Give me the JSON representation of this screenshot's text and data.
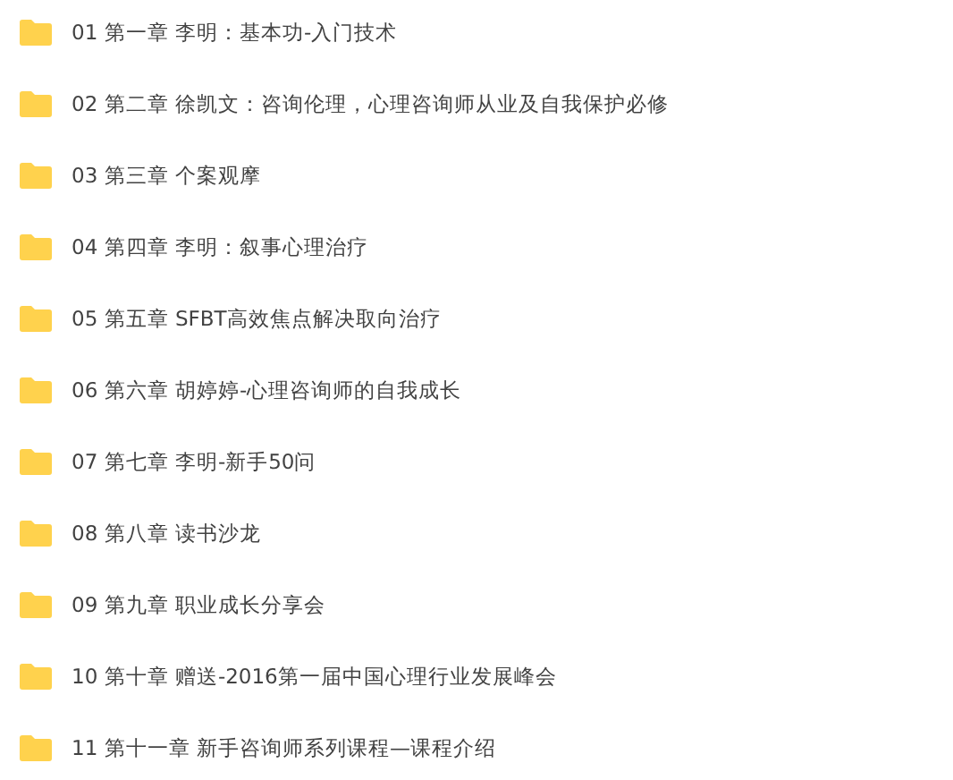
{
  "folders": [
    {
      "name": "01 第一章 李明：基本功-入门技术"
    },
    {
      "name": "02 第二章 徐凯文：咨询伦理，心理咨询师从业及自我保护必修"
    },
    {
      "name": "03 第三章 个案观摩"
    },
    {
      "name": "04 第四章 李明：叙事心理治疗"
    },
    {
      "name": "05 第五章 SFBT高效焦点解决取向治疗"
    },
    {
      "name": "06 第六章 胡婷婷-心理咨询师的自我成长"
    },
    {
      "name": "07 第七章 李明-新手50问"
    },
    {
      "name": "08 第八章 读书沙龙"
    },
    {
      "name": "09 第九章 职业成长分享会"
    },
    {
      "name": "10 第十章 赠送-2016第一届中国心理行业发展峰会"
    },
    {
      "name": "11 第十一章 新手咨询师系列课程—课程介绍"
    }
  ]
}
